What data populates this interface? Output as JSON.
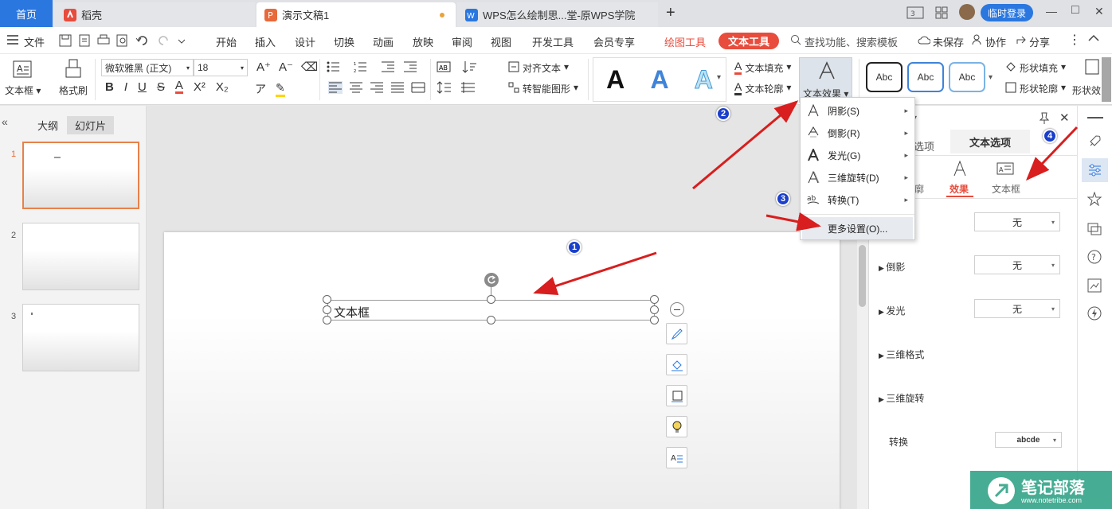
{
  "tabs": {
    "home": "首页",
    "docer": "稻壳",
    "ppt": "演示文稿1",
    "web": "WPS怎么绘制思...堂-原WPS学院",
    "add": "+"
  },
  "window": {
    "login": "临时登录",
    "minimize": "—",
    "maximize": "□",
    "close": "✕"
  },
  "menu": {
    "file": "文件",
    "items": [
      "开始",
      "插入",
      "设计",
      "切换",
      "动画",
      "放映",
      "审阅",
      "视图",
      "开发工具",
      "会员专享"
    ],
    "drawing_tools": "绘图工具",
    "text_tools": "文本工具",
    "search": "查找功能、搜索模板",
    "unsaved": "未保存",
    "collab": "协作",
    "share": "分享"
  },
  "ribbon": {
    "textbox": "文本框",
    "format_painter": "格式刷",
    "font_name": "微软雅黑 (正文)",
    "font_size": "18",
    "align_text": "对齐文本",
    "smart_shape": "转智能图形",
    "text_fill": "文本填充",
    "text_outline": "文本轮廓",
    "text_effect": "文本效果",
    "style_letter": "A",
    "abc": "Abc",
    "shape_fill": "形状填充",
    "shape_outline": "形状轮廓",
    "shape_effect": "形状效"
  },
  "leftpane": {
    "outline": "大纲",
    "slides": "幻灯片",
    "collapse": "«",
    "numbers": [
      "1",
      "2",
      "3"
    ]
  },
  "slide": {
    "textbox_text": "文本框"
  },
  "dropdown": {
    "items": [
      {
        "label": "阴影(S)"
      },
      {
        "label": "倒影(R)"
      },
      {
        "label": "发光(G)"
      },
      {
        "label": "三维旋转(D)"
      },
      {
        "label": "转换(T)"
      }
    ],
    "more": "更多设置(O)..."
  },
  "rightpane": {
    "tab_shape": "选项",
    "tab_text": "文本选项",
    "sub_outline": "轮廓",
    "sub_effect": "效果",
    "sub_textbox": "文本框",
    "rows": [
      {
        "label": "",
        "value": "无"
      },
      {
        "label": "倒影",
        "value": "无"
      },
      {
        "label": "发光",
        "value": "无"
      },
      {
        "label": "三维格式",
        "value": ""
      },
      {
        "label": "三维旋转",
        "value": ""
      }
    ],
    "transform_label": "转换",
    "transform_value": "abcde"
  },
  "badges": [
    "1",
    "2",
    "3",
    "4"
  ],
  "watermark": {
    "text": "笔记部落",
    "url": "www.notetribe.com"
  },
  "colors": {
    "accent": "#2a77e0",
    "red": "#e84c3d",
    "arrow": "#d81e1e",
    "badge": "#1a3fcc"
  }
}
